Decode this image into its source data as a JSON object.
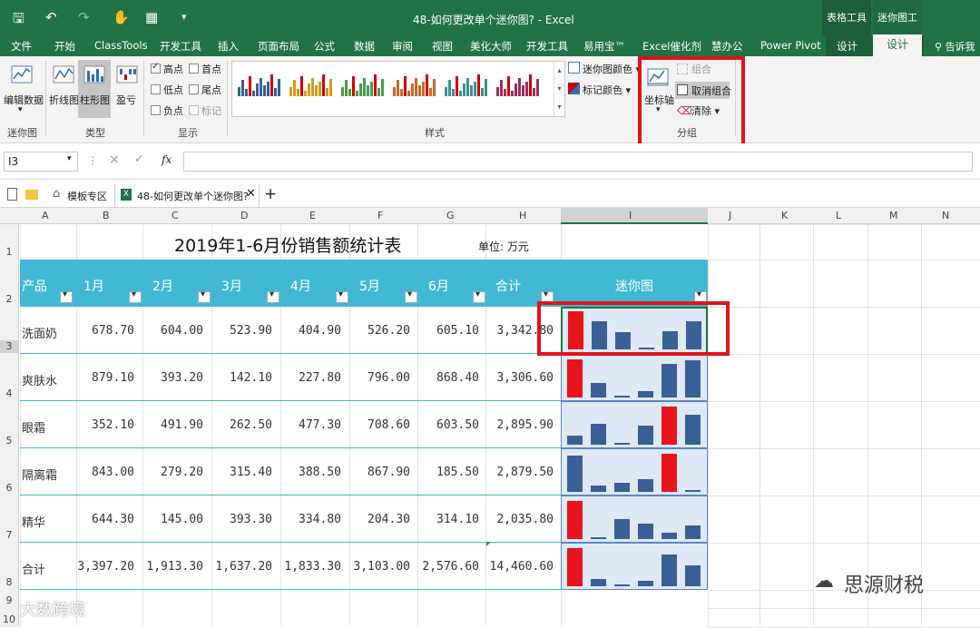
{
  "titlebar": {
    "doc_title": "48-如何更改单个迷你图? - Excel",
    "ctx_table": "表格工具",
    "ctx_sparkline": "迷你图工具"
  },
  "tabs": [
    "文件",
    "开始",
    "ClassTools",
    "开发工具",
    "插入",
    "页面布局",
    "公式",
    "数据",
    "审阅",
    "视图",
    "美化大师",
    "开发工具",
    "易用宝™",
    "Excel催化剂",
    "慧办公",
    "Power Pivot",
    "设计",
    "设计"
  ],
  "tell_me": "告诉我您",
  "ribbon": {
    "edit_data": "编辑数据",
    "group_sparkline": "迷你图",
    "line": "折线图",
    "column": "柱形图",
    "winloss": "盈亏",
    "group_type": "类型",
    "high_point": "高点",
    "first_point": "首点",
    "low_point": "低点",
    "last_point": "尾点",
    "negative_point": "负点",
    "markers": "标记",
    "group_show": "显示",
    "group_style": "样式",
    "sparkline_color": "迷你图颜色",
    "marker_color": "标记颜色",
    "axis": "坐标轴",
    "group": "组合",
    "ungroup": "取消组合",
    "clear": "清除",
    "group_group": "分组"
  },
  "formula": {
    "namebox": "I3",
    "cancel": "×",
    "enter": "✓",
    "fx": "fx",
    "value": ""
  },
  "doctabs": {
    "template_tab": "模板专区",
    "file_tab": "48-如何更改单个迷你图?"
  },
  "columns": [
    "A",
    "B",
    "C",
    "D",
    "E",
    "F",
    "G",
    "H",
    "I",
    "J",
    "K",
    "L",
    "M",
    "N"
  ],
  "rows": [
    "1",
    "2",
    "3",
    "4",
    "5",
    "6",
    "7",
    "8",
    "9",
    "10"
  ],
  "sheet": {
    "title": "2019年1-6月份销售额统计表",
    "unit": "单位: 万元",
    "headers": [
      "产品",
      "1月",
      "2月",
      "3月",
      "4月",
      "5月",
      "6月",
      "合计",
      "迷你图"
    ],
    "data": [
      {
        "name": "洗面奶",
        "vals": [
          "678.70",
          "604.00",
          "523.90",
          "404.90",
          "526.20",
          "605.10",
          "3,342.80"
        ],
        "spark": [
          678.7,
          604.0,
          523.9,
          404.9,
          526.2,
          605.1
        ]
      },
      {
        "name": "爽肤水",
        "vals": [
          "879.10",
          "393.20",
          "142.10",
          "227.80",
          "796.00",
          "868.40",
          "3,306.60"
        ],
        "spark": [
          879.1,
          393.2,
          142.1,
          227.8,
          796.0,
          868.4
        ]
      },
      {
        "name": "眼霜",
        "vals": [
          "352.10",
          "491.90",
          "262.50",
          "477.30",
          "708.60",
          "603.50",
          "2,895.90"
        ],
        "spark": [
          352.1,
          491.9,
          262.5,
          477.3,
          708.6,
          603.5
        ]
      },
      {
        "name": "隔离霜",
        "vals": [
          "843.00",
          "279.20",
          "315.40",
          "388.50",
          "867.90",
          "185.50",
          "2,879.50"
        ],
        "spark": [
          843.0,
          279.2,
          315.4,
          388.5,
          867.9,
          185.5
        ]
      },
      {
        "name": "精华",
        "vals": [
          "644.30",
          "145.00",
          "393.30",
          "334.80",
          "204.30",
          "314.10",
          "2,035.80"
        ],
        "spark": [
          644.3,
          145.0,
          393.3,
          334.8,
          204.3,
          314.1
        ]
      },
      {
        "name": "合计",
        "vals": [
          "3,397.20",
          "1,913.30",
          "1,637.20",
          "1,833.30",
          "3,103.00",
          "2,576.60",
          "14,460.60"
        ],
        "spark": [
          3397.2,
          1913.3,
          1637.2,
          1833.3,
          3103.0,
          2576.6
        ]
      }
    ]
  },
  "colors": {
    "excel_green": "#217346",
    "header_teal": "#41b8d3",
    "bar_blue": "#3a5f96",
    "bar_red": "#e8141b",
    "highlight": "#e0131a"
  },
  "watermarks": {
    "left": "大数跨境",
    "right": "思源财税"
  }
}
